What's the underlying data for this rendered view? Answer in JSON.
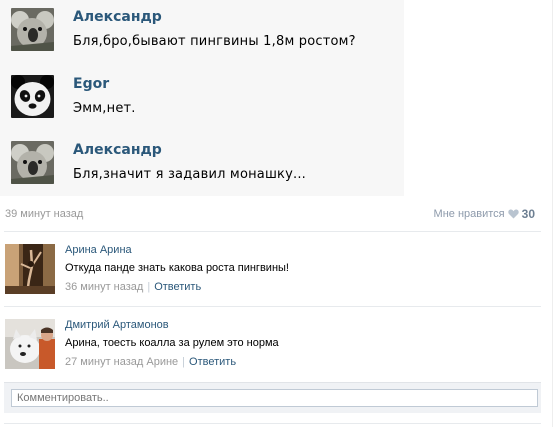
{
  "chat": {
    "messages": [
      {
        "author": "Александр",
        "text": "Бля,бро,бывают пингвины 1,8м ростом?",
        "avatar": "koala-avatar"
      },
      {
        "author": "Egor",
        "text": "Эмм,нет.",
        "avatar": "panda-avatar"
      },
      {
        "author": "Александр",
        "text": "Бля,значит я задавил монашку...",
        "avatar": "koala-avatar"
      }
    ]
  },
  "post": {
    "time": "39 минут назад",
    "like_label": "Мне нравится",
    "like_count": "30",
    "like_icon": "heart-icon"
  },
  "comments": [
    {
      "author": "Арина Арина",
      "text": "Откуда панде знать какова роста пингвины!",
      "time": "36 минут назад",
      "reply_label": "Ответить",
      "avatar": "ballerina-avatar"
    },
    {
      "author": "Дмитрий Артамонов",
      "text": "Арина, тоесть коалла за рулем это норма",
      "time": "27 минут назад Арине",
      "reply_label": "Ответить",
      "avatar": "dog-avatar"
    }
  ],
  "composer": {
    "placeholder": "Комментировать.."
  },
  "colors": {
    "link": "#2b587a",
    "muted": "#999999",
    "like_muted": "#8d9aab",
    "chat_bg": "#f7f7f7"
  }
}
